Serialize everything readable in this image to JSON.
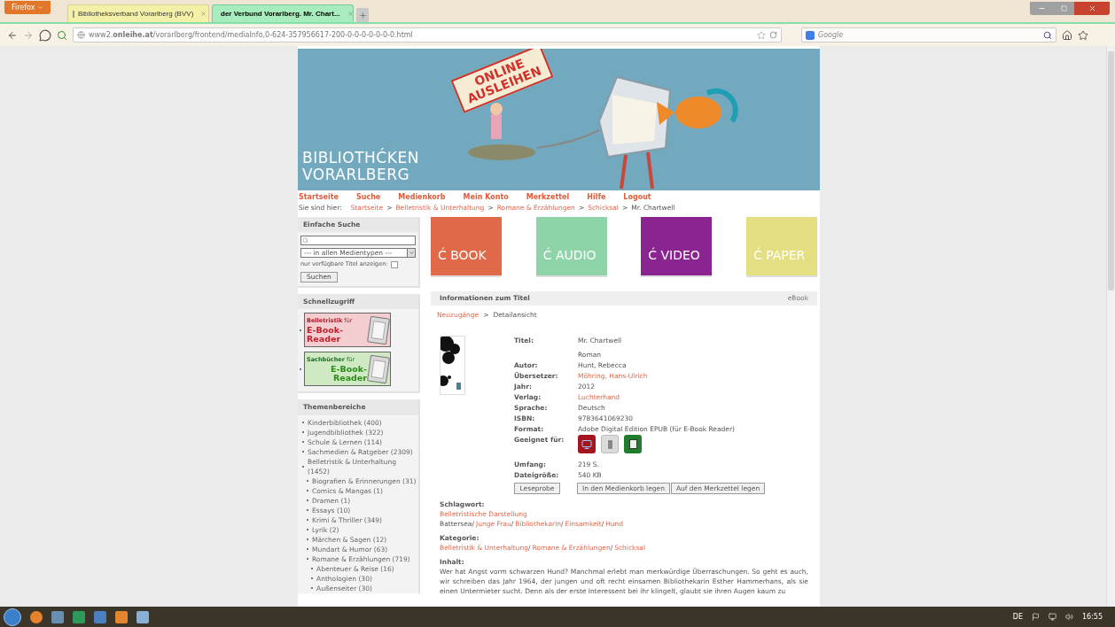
{
  "browser": {
    "menu_button": "Firefox",
    "tabs": [
      {
        "title": "Bibliotheksverband Vorarlberg (BVV)",
        "selected": false
      },
      {
        "title": "der Verbund Vorarlberg. Mr. Chart...",
        "selected": true
      }
    ],
    "url": "www2.**onleihe.at**/vorarlberg/frontend/mediaInfo,0-624-357956617-200-0-0-0-0-0-0-0.html",
    "search_placeholder": "Google"
  },
  "banner": {
    "sign": [
      "ONLINE",
      "AUSLEIHEN"
    ],
    "logo": [
      "BIBLIOTHĆKEN",
      "VORARLBERG"
    ]
  },
  "nav": [
    "Startseite",
    "Suche",
    "Medienkorb",
    "Mein Konto",
    "Merkzettel",
    "Hilfe",
    "Logout"
  ],
  "breadcrumb": {
    "label": "Sie sind hier:",
    "separator": ">",
    "items": [
      {
        "text": "Startseite",
        "link": true
      },
      {
        "text": "Belletristik & Unterhaltung",
        "link": true
      },
      {
        "text": "Romane & Erzählungen",
        "link": true
      },
      {
        "text": "Schicksal",
        "link": true
      },
      {
        "text": "Mr. Chartwell",
        "link": false
      }
    ]
  },
  "simple_search": {
    "title": "Einfache Suche",
    "media_select": "--- in allen Medientypen ---",
    "available_only": {
      "label": "nur verfügbare Titel anzeigen:",
      "checked": false
    },
    "button": "Suchen"
  },
  "quick_access": {
    "title": "Schnellzugriff",
    "items": [
      {
        "heading": "**Belletristik** für",
        "subtitle": "E-Book-Reader",
        "color": "#f3cdd0"
      },
      {
        "heading": "**Sachbücher** für",
        "subtitle": "E-Book-Reader",
        "color": "#cfe9c2"
      }
    ]
  },
  "topics": {
    "title": "Themenbereiche",
    "items": [
      {
        "label": "Kinderbibliothek (400)"
      },
      {
        "label": "Jugendbibliothek (322)"
      },
      {
        "label": "Schule & Lernen (114)"
      },
      {
        "label": "Sachmedien & Ratgeber (2309)"
      },
      {
        "label": "Belletristik & Unterhaltung (1452)",
        "children": [
          {
            "label": "Biografien & Erinnerungen (31)"
          },
          {
            "label": "Comics & Mangas (1)"
          },
          {
            "label": "Dramen (1)"
          },
          {
            "label": "Essays (10)"
          },
          {
            "label": "Krimi & Thriller (349)"
          },
          {
            "label": "Lyrik (2)"
          },
          {
            "label": "Märchen & Sagen (12)"
          },
          {
            "label": "Mundart & Humor (63)"
          },
          {
            "label": "Romane & Erzählungen (719)",
            "children": [
              {
                "label": "Abenteuer & Reise (16)"
              },
              {
                "label": "Anthologien (30)"
              },
              {
                "label": "Außenseiter (30)"
              }
            ]
          }
        ]
      }
    ]
  },
  "media_tiles": [
    {
      "label": "Ć BOOK",
      "color": "#e0694a"
    },
    {
      "label": "Ć AUDIO",
      "color": "#8fd4a9"
    },
    {
      "label": "Ć VIDEO",
      "color": "#8a2490"
    },
    {
      "label": "Ć PAPER",
      "color": "#e3df82"
    }
  ],
  "info": {
    "title": "Informationen zum Titel",
    "media_type": "eBook",
    "separator": ">",
    "breadcrumb": [
      {
        "text": "Neuzugänge",
        "link": true
      },
      {
        "text": "Detailansicht",
        "link": false
      }
    ],
    "fields": [
      {
        "kind": "text",
        "label": "Titel:",
        "value": "Mr. Chartwell",
        "link": false
      },
      {
        "kind": "text",
        "value": "Roman",
        "link": false
      },
      {
        "kind": "text",
        "label": "Autor:",
        "value": "Hunt, Rebecca",
        "link": false
      },
      {
        "kind": "text",
        "label": "Übersetzer:",
        "value": "Möhring, Hans-Ulrich",
        "link": true
      },
      {
        "kind": "text",
        "label": "Jahr:",
        "value": "2012",
        "link": false
      },
      {
        "kind": "text",
        "label": "Verlag:",
        "value": "Luchterhand",
        "link": true
      },
      {
        "kind": "text",
        "label": "Sprache:",
        "value": "Deutsch",
        "link": false
      },
      {
        "kind": "text",
        "label": "ISBN:",
        "value": "9783641069230",
        "link": false
      },
      {
        "kind": "text",
        "label": "Format:",
        "value": "Adobe Digital Edition EPUB (für E-Book Reader)",
        "link": false
      },
      {
        "kind": "devices",
        "label": "Geeignet für:",
        "devices": [
          {
            "kind": "pc"
          },
          {
            "kind": "mp3"
          },
          {
            "kind": "reader"
          }
        ]
      },
      {
        "kind": "text",
        "label": "Umfang:",
        "value": "219 S.",
        "link": false
      },
      {
        "kind": "text",
        "label": "Dateigröße:",
        "value": "540 KB",
        "link": false
      }
    ],
    "buttons": [
      "Leseprobe",
      "In den Medienkorb legen",
      "Auf den Merkzettel legen"
    ],
    "sections": [
      {
        "kind": "links",
        "title": "Schlagwort:",
        "separator": "/",
        "lines": [
          [
            {
              "text": "Belletristische Darstellung",
              "link": true
            }
          ],
          [
            {
              "text": "Battersea",
              "link": false
            },
            {
              "text": "Junge Frau",
              "link": true
            },
            {
              "text": "Bibliothekarin",
              "link": true
            },
            {
              "text": "Einsamkeit",
              "link": true
            },
            {
              "text": "Hund",
              "link": true
            }
          ]
        ]
      },
      {
        "kind": "links",
        "title": "Kategorie:",
        "separator": "/",
        "lines": [
          [
            {
              "text": "Belletristik & Unterhaltung",
              "link": true
            },
            {
              "text": "Romane & Erzählungen",
              "link": true
            },
            {
              "text": "Schicksal",
              "link": true
            }
          ]
        ]
      },
      {
        "kind": "text",
        "title": "Inhalt:",
        "text": "Wer hat Angst vorm schwarzen Hund? Manchmal erlebt man merkwürdige Überraschungen. So geht es auch, wir schreiben das Jahr 1964, der jungen und oft recht einsamen Bibliothekarin Esther Hammerhans, als sie einen Untermieter sucht. Denn als der erste Interessent bei ihr klingelt, glaubt sie ihren Augen kaum zu"
      }
    ]
  },
  "taskbar": {
    "language": "DE",
    "clock": "16:55"
  }
}
